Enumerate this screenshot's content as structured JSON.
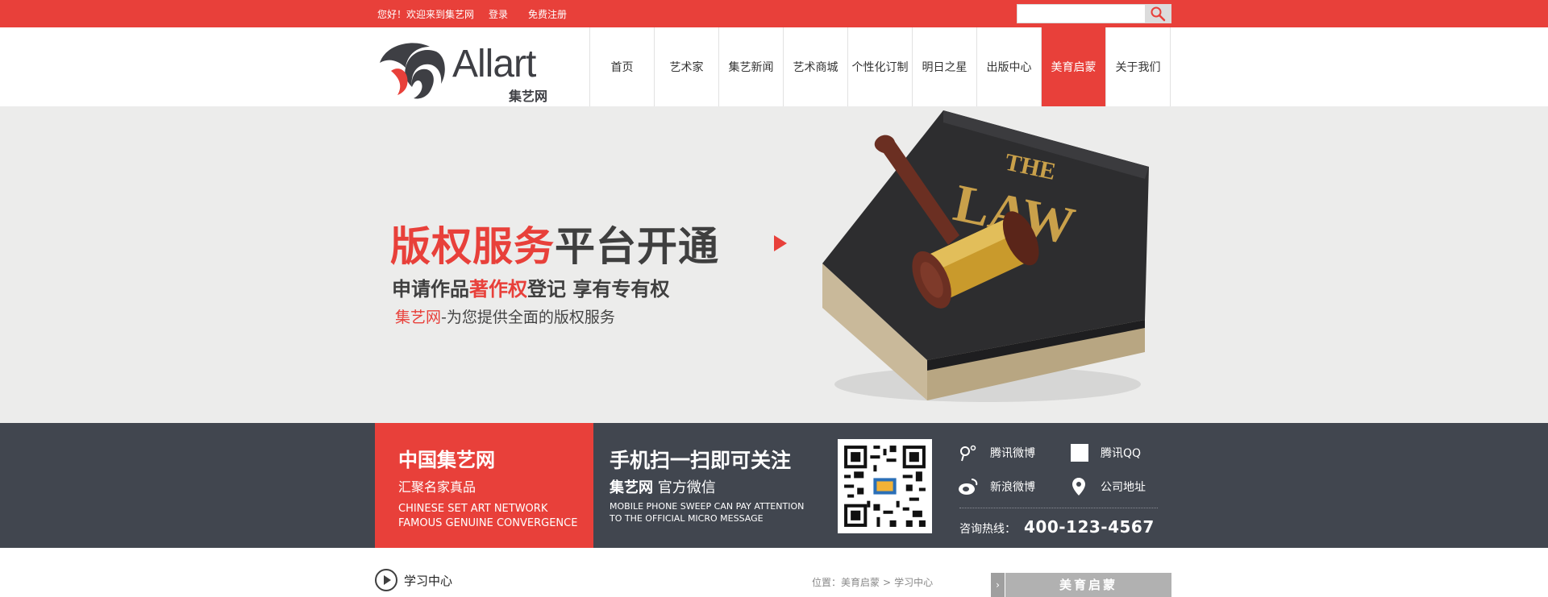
{
  "topbar": {
    "greeting": "您好！欢迎来到集艺网",
    "login": "登录",
    "register": "免费注册",
    "search_placeholder": ""
  },
  "header": {
    "logo_brand": "Allart",
    "logo_cn": "集艺网",
    "nav": [
      "首页",
      "艺术家",
      "集艺新闻",
      "艺术商城",
      "个性化订制",
      "明日之星",
      "出版中心",
      "美育启蒙",
      "关于我们"
    ],
    "active_nav": "美育启蒙"
  },
  "banner": {
    "title_red": "版权服务",
    "title_dark": "平台开通",
    "line2_a": "申请作品",
    "line2_red": "著作权",
    "line2_b": "登记 享有专有权",
    "line3_red": "集艺网",
    "line3_b": "-为您提供全面的版权服务",
    "book_text_1": "THE",
    "book_text_2": "LAW"
  },
  "info": {
    "red_title": "中国集艺网",
    "red_sub": "汇聚名家真品",
    "red_en1": "CHINESE SET ART NETWORK",
    "red_en2": "FAMOUS GENUINE CONVERGENCE",
    "mid_title": "手机扫一扫即可关注",
    "mid_sub_bold": "集艺网",
    "mid_sub": " 官方微信",
    "mid_en1": "MOBILE PHONE SWEEP CAN PAY ATTENTION",
    "mid_en2": "TO THE OFFICIAL MICRO MESSAGE",
    "social": {
      "tencent_weibo": "腾讯微博",
      "tencent_qq": "腾讯QQ",
      "sina_weibo": "新浪微博",
      "address": "公司地址"
    },
    "hotline_label": "咨询热线：",
    "hotline_number": "400-123-4567"
  },
  "bottom": {
    "section_title": "学习中心",
    "breadcrumb_prefix": "位置：",
    "breadcrumb_1": "美育启蒙",
    "breadcrumb_2": "学习中心",
    "side_tab": "美育启蒙"
  },
  "colors": {
    "brand_red": "#e8403a",
    "strip_dark": "#41464f",
    "banner_bg": "#ececeb"
  }
}
